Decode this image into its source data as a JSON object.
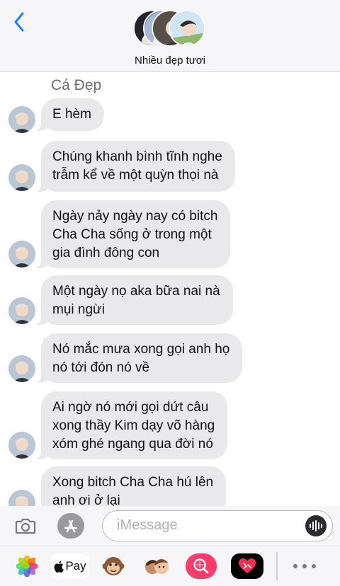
{
  "header": {
    "title": "Nhiều đẹp tươi",
    "back_icon": "chevron-left-icon",
    "accent_color": "#1a84ff"
  },
  "chat": {
    "sender_name": "Cá Đẹp",
    "bubble_color": "#e9e9eb",
    "messages": [
      {
        "text": "E hèm"
      },
      {
        "text": "Chúng khanh bình tĩnh nghe\ntrẫm kể về một quỳn thọi nà"
      },
      {
        "text": "Ngày nảy ngày nay có bitch\nCha Cha sống ở trong một\ngia đình đông con"
      },
      {
        "text": "Một ngày nọ aka bữa nai nà\nmụi ngừi"
      },
      {
        "text": "Nó mắc mưa xong gọi anh họ\nnó tới đón nó về"
      },
      {
        "text": "Ai ngờ nó mới gọi dứt câu\nxong thầy Kim dạy võ hàng\nxóm ghé ngang qua đời nó"
      },
      {
        "text": "Xong bitch Cha Cha hú lên\nanh ơi ở lại"
      }
    ]
  },
  "input_bar": {
    "camera_icon": "camera-icon",
    "appstore_icon": "app-store-icon",
    "placeholder": "iMessage",
    "voice_icon": "waveform-icon"
  },
  "app_drawer": {
    "apps": [
      {
        "name": "photos-app-icon"
      },
      {
        "name": "apple-pay-app",
        "label": "Pay"
      },
      {
        "name": "monkey-animoji-icon"
      },
      {
        "name": "memoji-stickers-icon"
      },
      {
        "name": "image-search-icon"
      },
      {
        "name": "digital-touch-heart-icon"
      }
    ],
    "more_icon": "more-dots-icon"
  }
}
